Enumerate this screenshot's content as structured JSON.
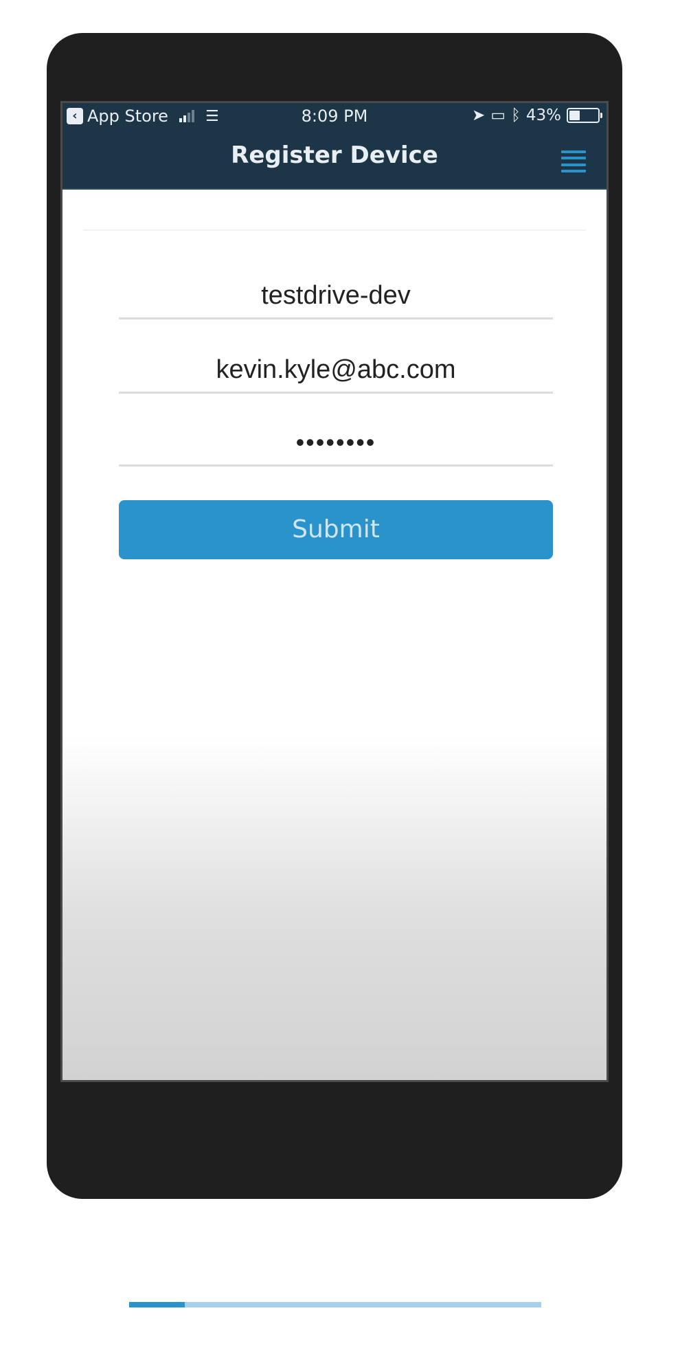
{
  "status_bar": {
    "back_app": "App Store",
    "time": "8:09 PM",
    "battery_text": "43%",
    "battery_level": 0.43
  },
  "nav": {
    "title": "Register Device",
    "menu_icon": "hamburger-icon"
  },
  "form": {
    "domain_value": "testdrive-dev",
    "email_value": "kevin.kyle@abc.com",
    "password_masked": "••••••••",
    "submit_label": "Submit"
  },
  "progress": {
    "value": 0.135
  },
  "colors": {
    "nav_bg": "#1c3547",
    "accent": "#2b93cc",
    "progress_track": "#a6d1ec"
  }
}
